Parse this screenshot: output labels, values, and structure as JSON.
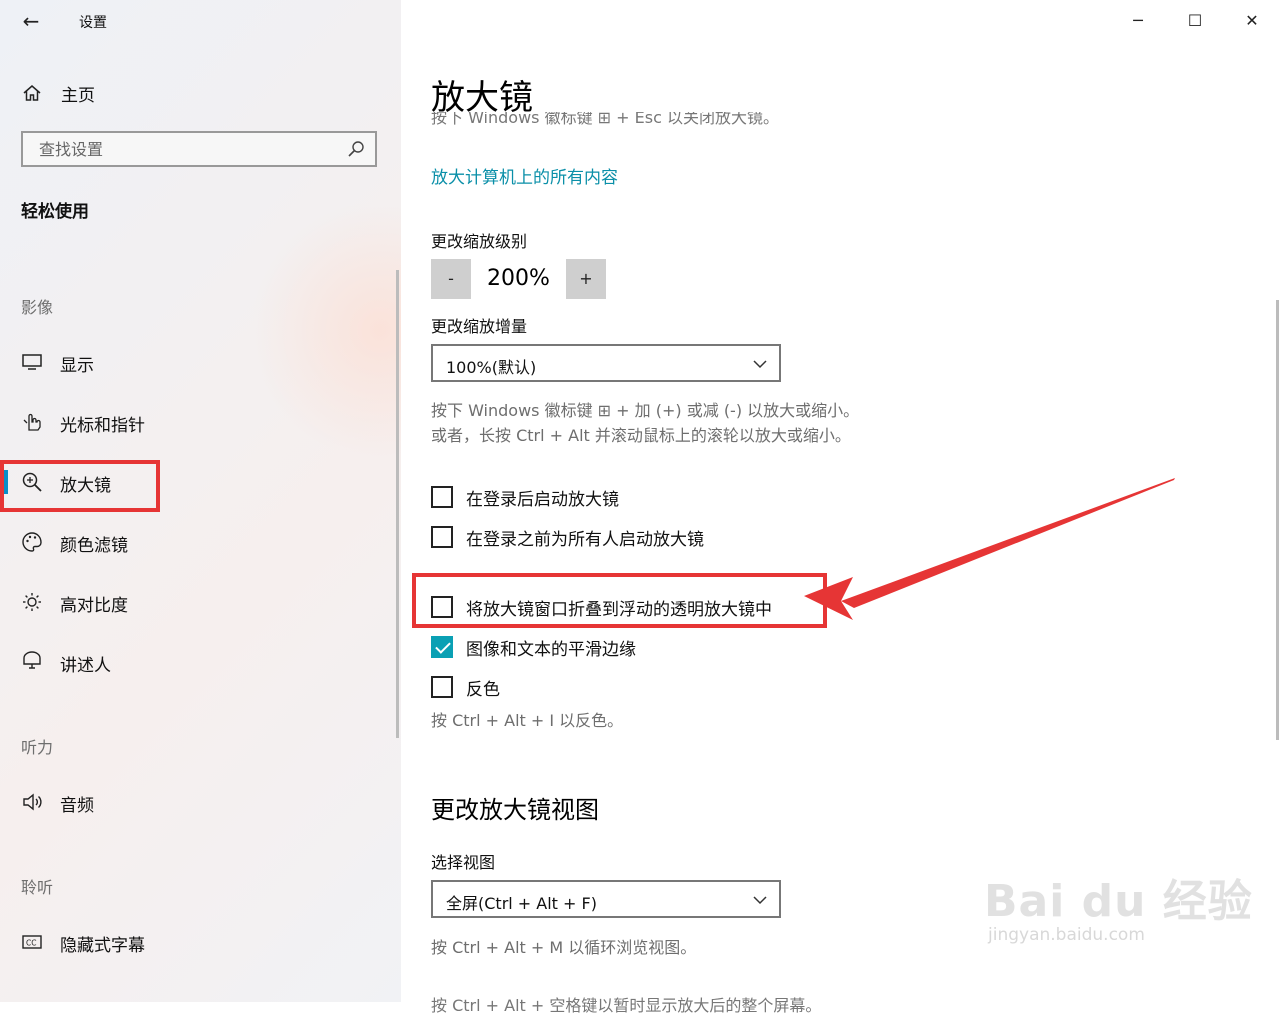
{
  "window": {
    "app_title": "设置",
    "back_icon": "←",
    "minimize": "─",
    "maximize": "☐",
    "close": "✕"
  },
  "sidebar": {
    "home": {
      "icon": "home-icon",
      "label": "主页"
    },
    "search": {
      "placeholder": "查找设置",
      "icon": "search-icon"
    },
    "section_title": "轻松使用",
    "groups": {
      "vision": "影像",
      "hearing": "听力",
      "interaction": "聆听"
    },
    "items": [
      {
        "label": "显示",
        "icon": "monitor-icon"
      },
      {
        "label": "光标和指针",
        "icon": "pointer-icon"
      },
      {
        "label": "放大镜",
        "icon": "magnifier-icon",
        "active": true
      },
      {
        "label": "颜色滤镜",
        "icon": "palette-icon"
      },
      {
        "label": "高对比度",
        "icon": "brightness-icon"
      },
      {
        "label": "讲述人",
        "icon": "narrator-icon"
      },
      {
        "label": "音频",
        "icon": "speaker-icon"
      },
      {
        "label": "隐藏式字幕",
        "icon": "cc-icon"
      }
    ]
  },
  "main": {
    "title": "放大镜",
    "clipped_text": "按下 Windows 徽标键 ⊞ + Esc 以关闭放大镜。",
    "link": "放大计算机上的所有内容",
    "zoom_level": {
      "label": "更改缩放级别",
      "minus": "-",
      "value": "200%",
      "plus": "+"
    },
    "zoom_increment": {
      "label": "更改缩放增量",
      "value": "100%(默认)"
    },
    "hint_zoom_1": "按下 Windows 徽标键 ⊞ + 加 (+) 或减 (-) 以放大或缩小。",
    "hint_zoom_2": "或者，长按 Ctrl + Alt 并滚动鼠标上的滚轮以放大或缩小。",
    "checkboxes": [
      {
        "label": "在登录后启动放大镜",
        "checked": false
      },
      {
        "label": "在登录之前为所有人启动放大镜",
        "checked": false
      },
      {
        "label": "将放大镜窗口折叠到浮动的透明放大镜中",
        "checked": false
      },
      {
        "label": "图像和文本的平滑边缘",
        "checked": true
      },
      {
        "label": "反色",
        "checked": false
      }
    ],
    "hint_invert": "按 Ctrl + Alt + I 以反色。",
    "view_section": {
      "title": "更改放大镜视图",
      "label": "选择视图",
      "value": "全屏(Ctrl + Alt + F)",
      "hint": "按 Ctrl + Alt + M 以循环浏览视图。"
    },
    "bottom_clipped": "按 Ctrl + Alt + 空格键以暂时显示放大后的整个屏幕。"
  },
  "annotation_color": "#e63535",
  "accent_color": "#0aa0b4",
  "watermark": {
    "brand": "Bai du 经验",
    "url": "jingyan.baidu.com"
  }
}
